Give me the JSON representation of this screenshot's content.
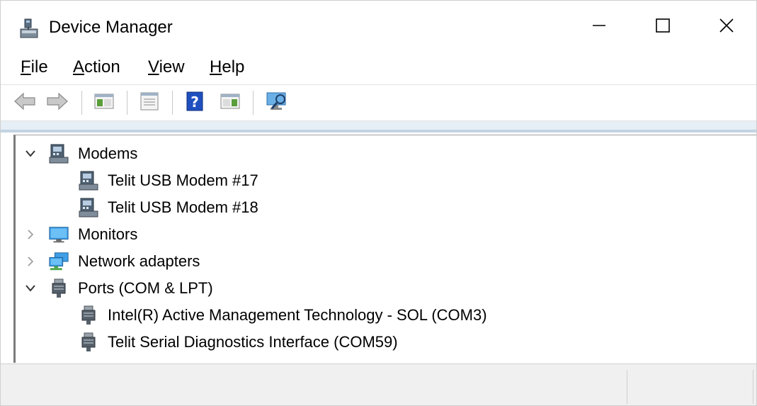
{
  "window": {
    "title": "Device Manager",
    "icon": "device-manager-icon"
  },
  "titlebar_buttons": {
    "minimize_icon": "minimize-icon",
    "maximize_icon": "maximize-icon",
    "close_icon": "close-icon"
  },
  "menu": [
    {
      "key": "F",
      "rest": "ile"
    },
    {
      "key": "A",
      "rest": "ction"
    },
    {
      "key": "V",
      "rest": "iew"
    },
    {
      "key": "H",
      "rest": "elp"
    }
  ],
  "toolbar": {
    "buttons": [
      "back-icon",
      "forward-icon",
      "show-hide-console-tree-icon",
      "properties-icon",
      "help-icon",
      "action-pane-icon",
      "scan-hardware-icon"
    ]
  },
  "tree": {
    "nodes": [
      {
        "label": "Modems",
        "icon": "modem-icon",
        "level": 0,
        "expanded": true
      },
      {
        "label": "Telit USB Modem #17",
        "icon": "modem-icon",
        "level": 1
      },
      {
        "label": "Telit USB Modem #18",
        "icon": "modem-icon",
        "level": 1
      },
      {
        "label": "Monitors",
        "icon": "monitor-icon",
        "level": 0,
        "expanded": false
      },
      {
        "label": "Network adapters",
        "icon": "network-adapter-icon",
        "level": 0,
        "expanded": false
      },
      {
        "label": "Ports (COM & LPT)",
        "icon": "port-icon",
        "level": 0,
        "expanded": true
      },
      {
        "label": "Intel(R) Active Management Technology - SOL (COM3)",
        "icon": "port-icon",
        "level": 1
      },
      {
        "label": "Telit Serial Diagnostics Interface (COM59)",
        "icon": "port-icon",
        "level": 1
      }
    ]
  },
  "colors": {
    "accent_blue": "#1f6fd1",
    "strip": "#e6eef6",
    "statusbar": "#f0f0f0"
  }
}
